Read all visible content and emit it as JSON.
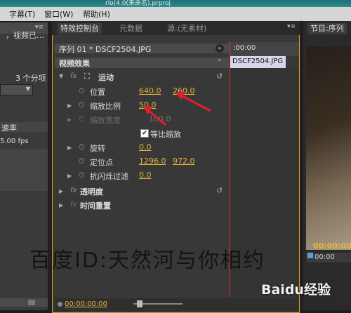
{
  "title_bar": {
    "text": "rlo(4.0(来命名).prproj"
  },
  "menu": {
    "items": [
      "字幕(T)",
      "窗口(W)",
      "帮助(H)"
    ]
  },
  "left_panel": {
    "text_partial": "，视频已…",
    "item_count": "3 个分项",
    "rate_header": "速率",
    "fps": "5.00 fps"
  },
  "tabs": {
    "effect_controls": "特效控制台",
    "metadata": "元数据",
    "source": "源:(无素材)",
    "program": "节目:序列"
  },
  "sequence_label": "序列 01 * DSCF2504.JPG",
  "video_effects_header": "视频效果",
  "motion": {
    "label": "运动",
    "position": {
      "label": "位置",
      "x": "640.0",
      "y": "260.0"
    },
    "scale": {
      "label": "缩放比例",
      "value": "50.0"
    },
    "scale_width": {
      "label": "缩放宽度",
      "value": "100.0"
    },
    "uniform_scale": {
      "label": "等比缩放",
      "checked": true
    },
    "rotation": {
      "label": "旋转",
      "value": "0.0"
    },
    "anchor_point": {
      "label": "定位点",
      "x": "1296.0",
      "y": "972.0"
    },
    "anti_flicker": {
      "label": "抗闪烁过滤",
      "value": "0.0"
    }
  },
  "opacity_label": "透明度",
  "time_remap_label": "时间重置",
  "timeline": {
    "ruler_tc": ":00:00",
    "clip_name": "DSCF2504.JPG"
  },
  "bottom_timecode": "00:00:00:00",
  "program": {
    "timecode": "00:00:00",
    "ruler_tc": "00:00"
  },
  "watermark": "百度ID:天然河与你相约",
  "logo_text": "Baidu经验",
  "colors": {
    "accent": "#e7b53a",
    "playhead": "#e0302a",
    "highlight_border": "#e0a020"
  }
}
